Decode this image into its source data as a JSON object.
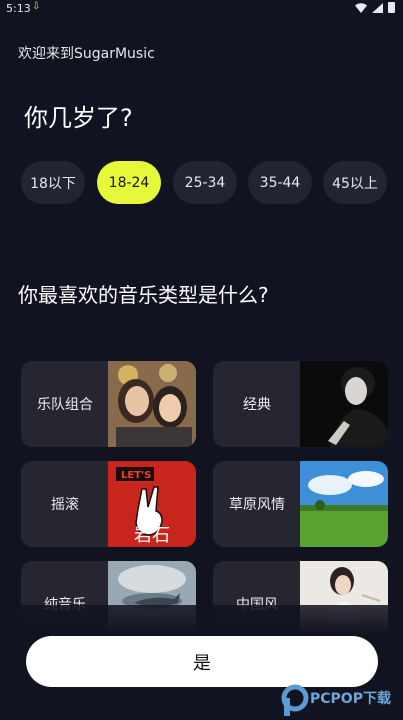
{
  "status_bar": {
    "time": "5:13"
  },
  "header": {
    "welcome": "欢迎来到SugarMusic",
    "age_question": "你几岁了?"
  },
  "age_options": [
    {
      "label": "18以下",
      "selected": false
    },
    {
      "label": "18-24",
      "selected": true
    },
    {
      "label": "25-34",
      "selected": false
    },
    {
      "label": "35-44",
      "selected": false
    },
    {
      "label": "45以上",
      "selected": false
    }
  ],
  "genre_question": "你最喜欢的音乐类型是什么?",
  "genres": [
    {
      "label": "乐队组合",
      "image": "duo-portrait"
    },
    {
      "label": "经典",
      "image": "pianist-portrait"
    },
    {
      "label": "摇滚",
      "image": "rock-hand-sign",
      "image_text": "岩石"
    },
    {
      "label": "草原风情",
      "image": "grassland-landscape"
    },
    {
      "label": "纯音乐",
      "image": "whale-sky"
    },
    {
      "label": "中国风",
      "image": "woman-portrait"
    }
  ],
  "confirm_label": "是",
  "colors": {
    "background": "#121320",
    "chip": "#232432",
    "chip_selected": "#e5f83a",
    "card": "#25262f",
    "button": "#ffffff"
  }
}
